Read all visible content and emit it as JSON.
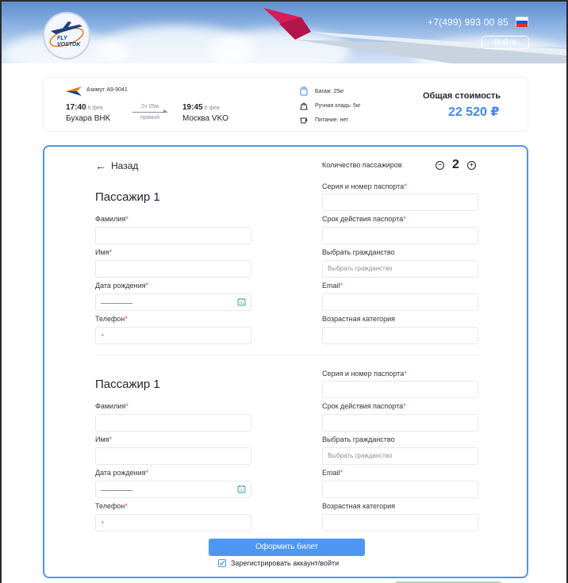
{
  "header": {
    "logo_text": "FLY VOSTOK",
    "phone": "+7(499) 993 00 85",
    "login_label": "Войти",
    "flag_colors": [
      "#ffffff",
      "#1c57d6",
      "#e0302a"
    ]
  },
  "flight": {
    "airline": "Азимут А9-9041",
    "departure": {
      "time": "17:40",
      "date": "6 фев",
      "city": "Бухара BHK"
    },
    "duration": "2ч 05м",
    "flight_type": "прямой",
    "arrival": {
      "time": "19:45",
      "date": "6 фев",
      "city": "Москва VKO"
    },
    "services": {
      "baggage": "Багаж: 25кг",
      "hand_luggage": "Ручная кладь: 5кг",
      "meal": "Питание: нет"
    },
    "total_label": "Общая стоимость",
    "total_price": "22 520 ₽"
  },
  "form": {
    "back_label": "Назад",
    "passengers_label": "Количество пассажиров",
    "passengers_count": "2",
    "labels": {
      "last_name": "Фамилия",
      "first_name": "Имя",
      "birth_date": "Дата рождения",
      "phone": "Телефон",
      "passport": "Серия и номер паспорта",
      "passport_expiry": "Срок действия паспорта",
      "citizenship": "Выбрать гражданство",
      "email": "Email",
      "age_category": "Возрастная категория"
    },
    "required_mark": "*",
    "citizenship_placeholder": "Выбрать гражданство",
    "phone_value": "+",
    "passengers": [
      {
        "title": "Пассажир 1"
      },
      {
        "title": "Пассажир 1"
      }
    ],
    "submit_label": "Оформить билет",
    "register_label": "Зарегистрировать аккаунт/войти",
    "register_checked": true
  },
  "colors": {
    "accent": "#4d97f2",
    "price": "#3f88f0",
    "required": "#e84040",
    "wing": "#d81b5a"
  }
}
